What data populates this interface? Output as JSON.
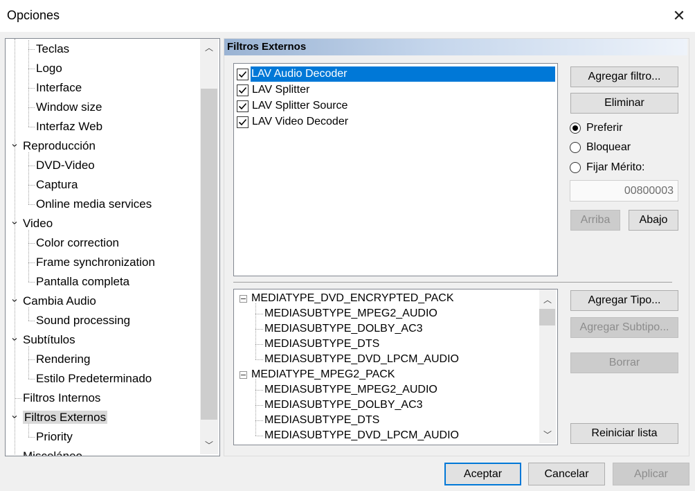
{
  "window": {
    "title": "Opciones",
    "close_icon": "close-icon"
  },
  "tree": {
    "items": [
      {
        "label": "Teclas",
        "level": 1
      },
      {
        "label": "Logo",
        "level": 1
      },
      {
        "label": "Interface",
        "level": 1
      },
      {
        "label": "Window size",
        "level": 1
      },
      {
        "label": "Interfaz Web",
        "level": 1
      },
      {
        "label": "Reproducción",
        "level": 0,
        "expanded": true
      },
      {
        "label": "DVD-Video",
        "level": 1
      },
      {
        "label": "Captura",
        "level": 1
      },
      {
        "label": "Online media services",
        "level": 1
      },
      {
        "label": "Video",
        "level": 0,
        "expanded": true
      },
      {
        "label": "Color correction",
        "level": 1
      },
      {
        "label": "Frame synchronization",
        "level": 1
      },
      {
        "label": "Pantalla completa",
        "level": 1
      },
      {
        "label": "Cambia Audio",
        "level": 0,
        "expanded": true
      },
      {
        "label": "Sound processing",
        "level": 1
      },
      {
        "label": "Subtítulos",
        "level": 0,
        "expanded": true
      },
      {
        "label": "Rendering",
        "level": 1
      },
      {
        "label": "Estilo Predeterminado",
        "level": 1
      },
      {
        "label": "Filtros Internos",
        "level": 0
      },
      {
        "label": "Filtros Externos",
        "level": 0,
        "expanded": true,
        "selected": true
      },
      {
        "label": "Priority",
        "level": 1
      },
      {
        "label": "Misceláneo",
        "level": 0
      }
    ]
  },
  "panel": {
    "title": "Filtros Externos",
    "filters": [
      {
        "label": "LAV Audio Decoder",
        "checked": true,
        "selected": true
      },
      {
        "label": "LAV Splitter",
        "checked": true
      },
      {
        "label": "LAV Splitter Source",
        "checked": true
      },
      {
        "label": "LAV Video Decoder",
        "checked": true
      }
    ],
    "buttons": {
      "add_filter": "Agregar filtro...",
      "remove": "Eliminar",
      "up": "Arriba",
      "down": "Abajo",
      "add_type": "Agregar Tipo...",
      "add_subtype": "Agregar Subtipo...",
      "delete": "Borrar",
      "reset_list": "Reiniciar lista"
    },
    "radios": {
      "prefer": "Preferir",
      "block": "Bloquear",
      "merit": "Fijar Mérito:",
      "selected": "prefer"
    },
    "merit_value": "00800003",
    "media_types": [
      {
        "label": "MEDIATYPE_DVD_ENCRYPTED_PACK",
        "type": "parent"
      },
      {
        "label": "MEDIASUBTYPE_MPEG2_AUDIO",
        "type": "child"
      },
      {
        "label": "MEDIASUBTYPE_DOLBY_AC3",
        "type": "child"
      },
      {
        "label": "MEDIASUBTYPE_DTS",
        "type": "child"
      },
      {
        "label": "MEDIASUBTYPE_DVD_LPCM_AUDIO",
        "type": "child"
      },
      {
        "label": "MEDIATYPE_MPEG2_PACK",
        "type": "parent"
      },
      {
        "label": "MEDIASUBTYPE_MPEG2_AUDIO",
        "type": "child"
      },
      {
        "label": "MEDIASUBTYPE_DOLBY_AC3",
        "type": "child"
      },
      {
        "label": "MEDIASUBTYPE_DTS",
        "type": "child"
      },
      {
        "label": "MEDIASUBTYPE_DVD_LPCM_AUDIO",
        "type": "child"
      }
    ]
  },
  "footer": {
    "ok": "Aceptar",
    "cancel": "Cancelar",
    "apply": "Aplicar"
  }
}
